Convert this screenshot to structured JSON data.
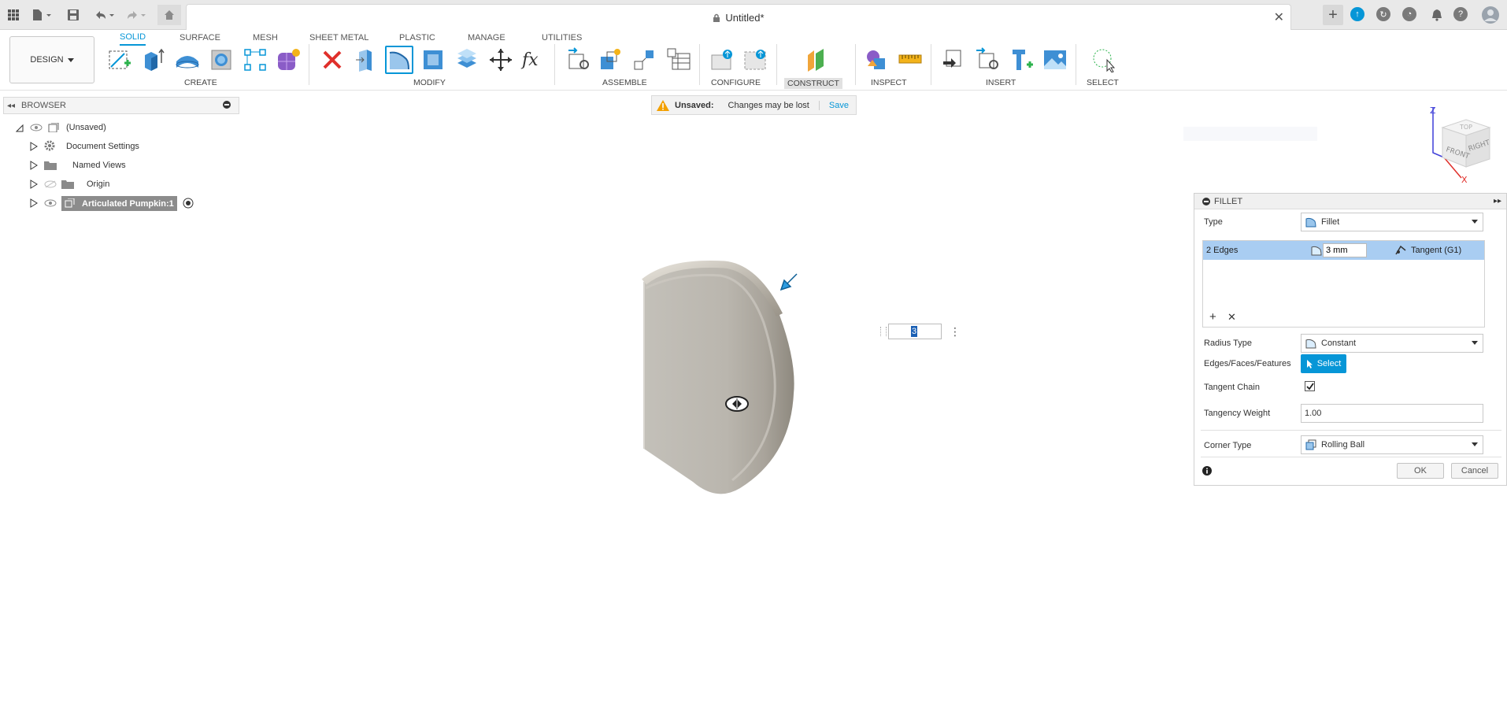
{
  "titlebar": {
    "document_title": "Untitled*"
  },
  "toolbar": {
    "workspace_label": "DESIGN",
    "tabs": [
      "SOLID",
      "SURFACE",
      "MESH",
      "SHEET METAL",
      "PLASTIC",
      "MANAGE",
      "UTILITIES"
    ],
    "groups": [
      "CREATE",
      "MODIFY",
      "ASSEMBLE",
      "CONFIGURE",
      "CONSTRUCT",
      "INSPECT",
      "INSERT",
      "SELECT"
    ]
  },
  "browser": {
    "title": "BROWSER",
    "root_label": "(Unsaved)",
    "items": [
      {
        "label": "Document Settings"
      },
      {
        "label": "Named Views"
      },
      {
        "label": "Origin"
      },
      {
        "label": "Articulated Pumpkin:1"
      }
    ]
  },
  "banner": {
    "status": "Unsaved:",
    "message": "Changes may be lost",
    "save_label": "Save"
  },
  "viewport": {
    "input_value": "3",
    "viewcube": {
      "top": "TOP",
      "front": "FRONT",
      "right": "RIGHT"
    },
    "axes": {
      "z": "Z",
      "x": "X"
    }
  },
  "fillet_panel": {
    "title": "FILLET",
    "type_label": "Type",
    "type_value": "Fillet",
    "edges_label": "2 Edges",
    "edges_radius": "3 mm",
    "edges_continuity": "Tangent (G1)",
    "radius_type_label": "Radius Type",
    "radius_type_value": "Constant",
    "edges_faces_label": "Edges/Faces/Features",
    "select_label": "Select",
    "tangent_chain_label": "Tangent Chain",
    "tangent_chain_checked": true,
    "tangency_weight_label": "Tangency Weight",
    "tangency_weight_value": "1.00",
    "corner_type_label": "Corner Type",
    "corner_type_value": "Rolling Ball",
    "ok_label": "OK",
    "cancel_label": "Cancel"
  },
  "colors": {
    "accent": "#0696d7",
    "selection": "#a9cdf2"
  }
}
